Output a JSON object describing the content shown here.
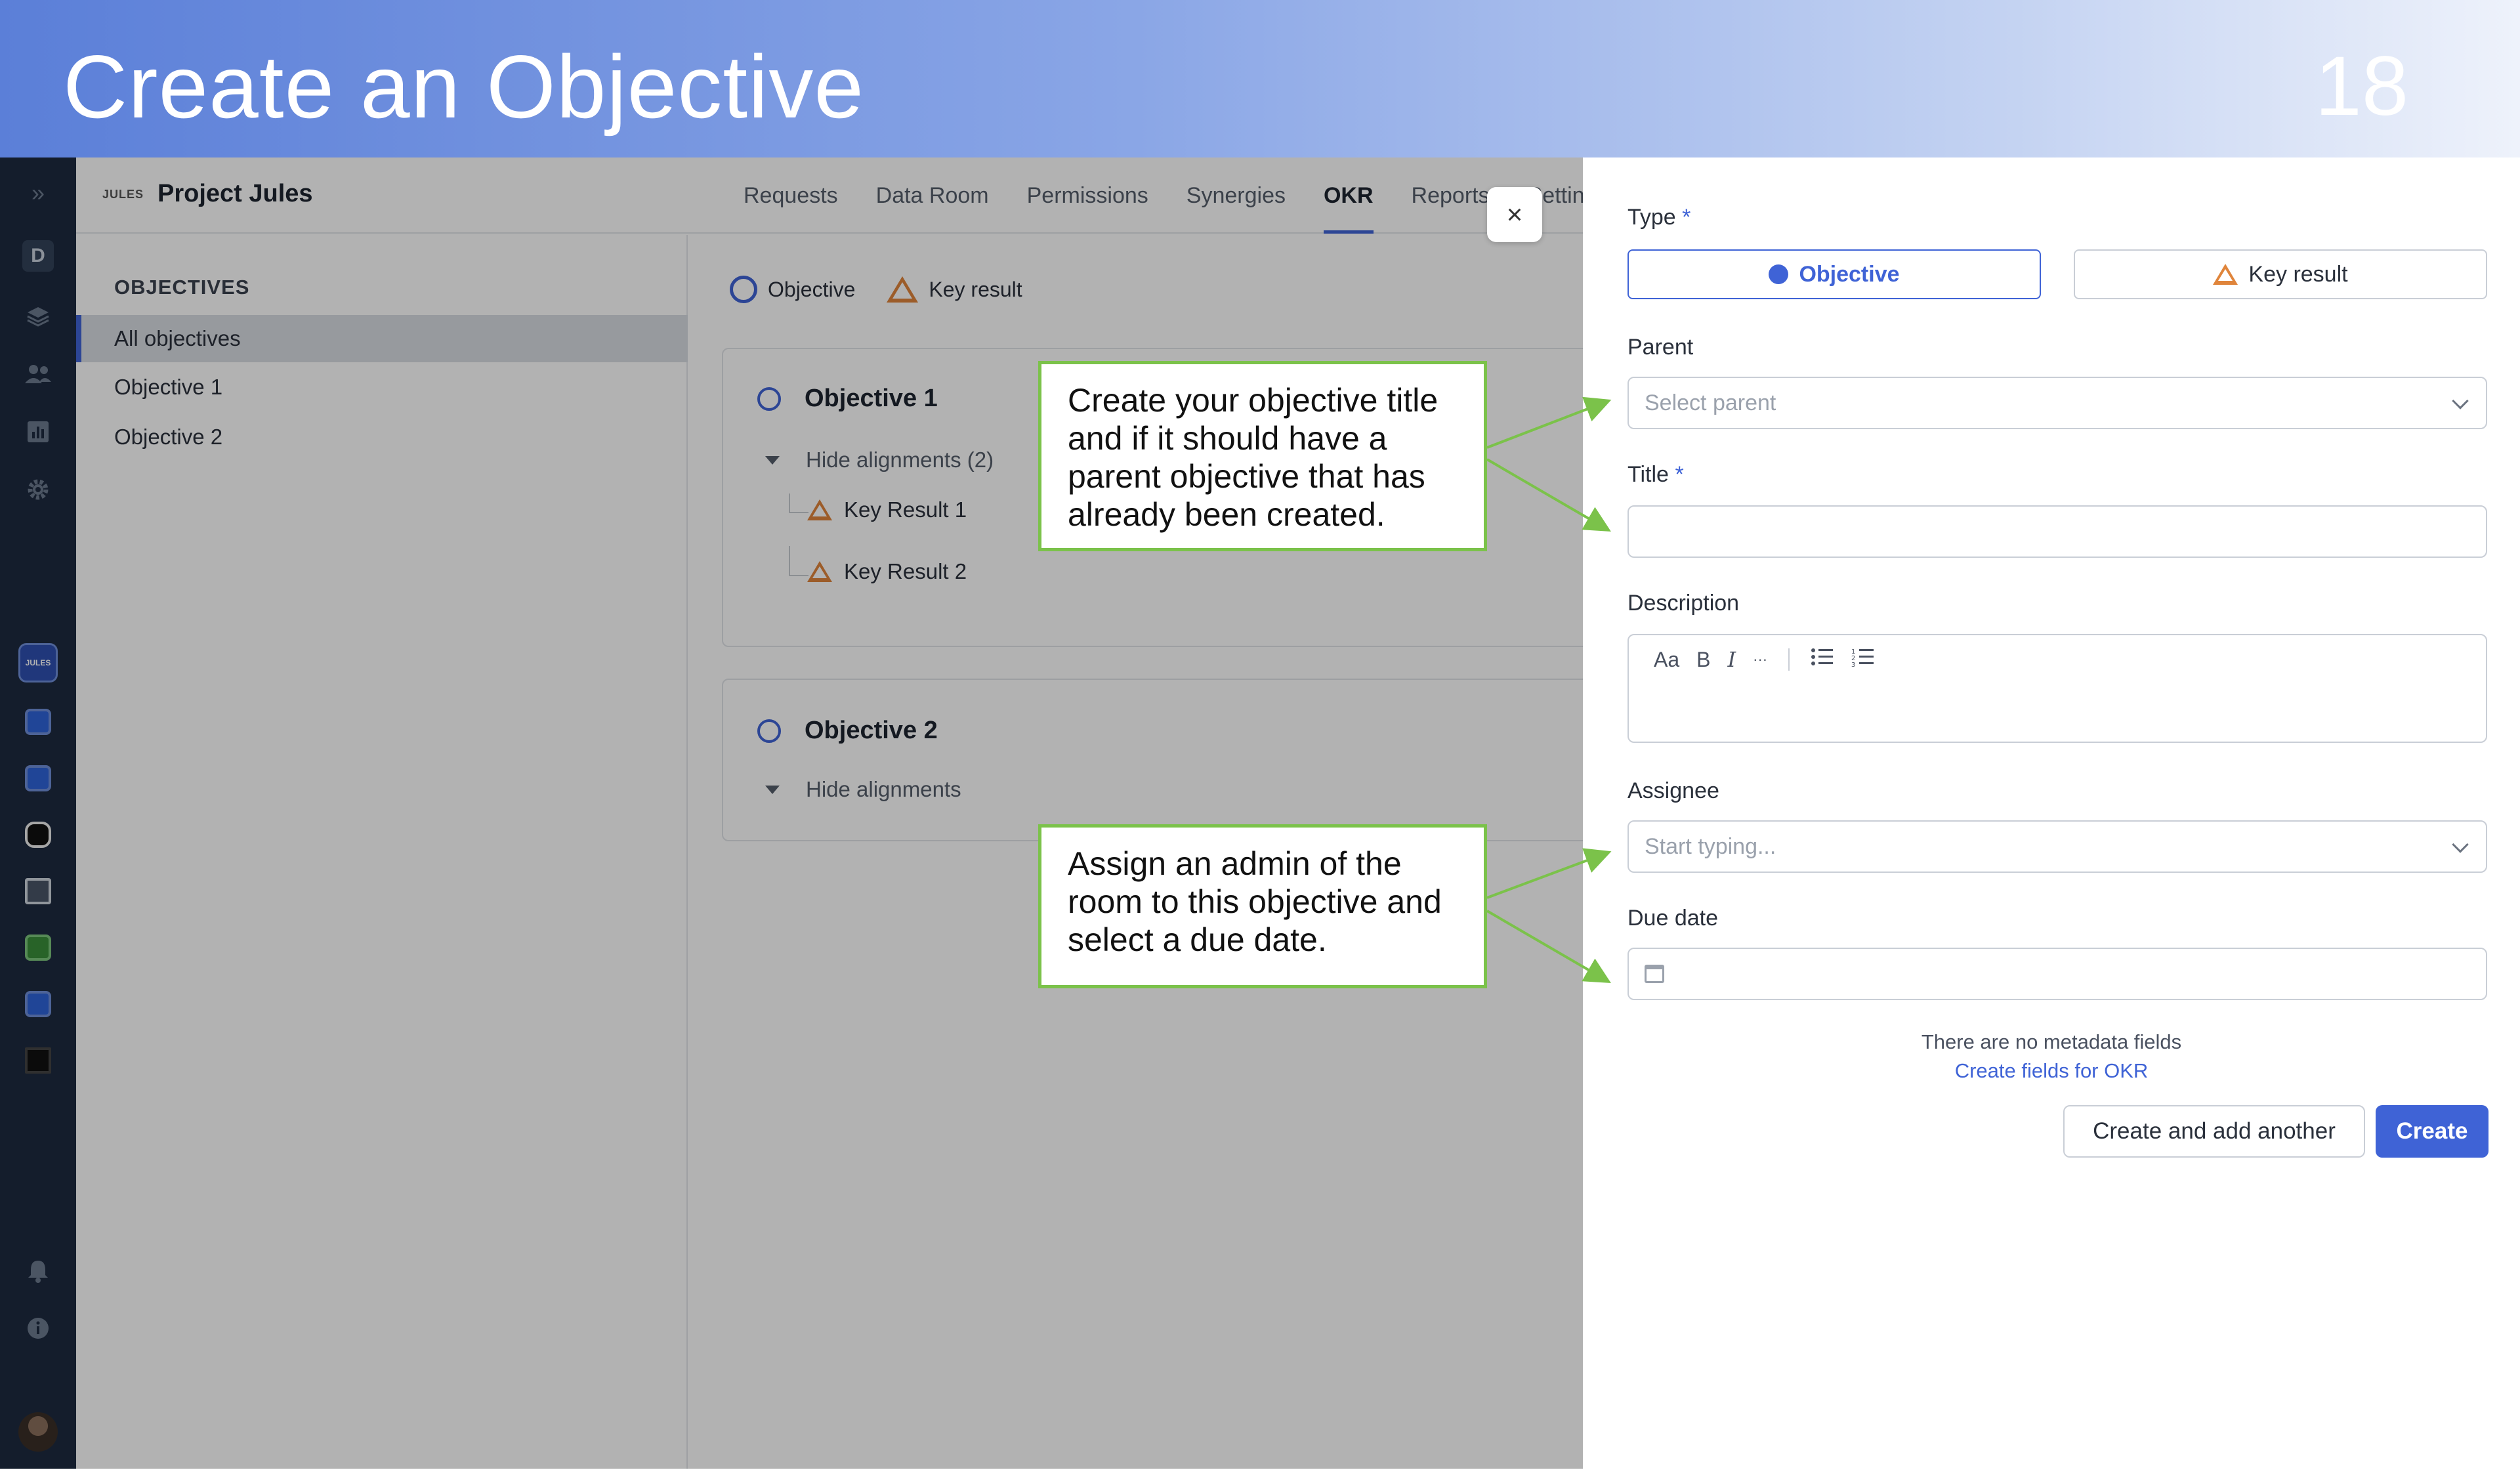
{
  "slide": {
    "title": "Create an Objective",
    "number": "18"
  },
  "rail": {
    "workspace_initial": "D",
    "active_app_label": "JULES"
  },
  "project": {
    "logo_text": "JULES",
    "name": "Project Jules"
  },
  "tabs": [
    {
      "label": "Requests"
    },
    {
      "label": "Data Room"
    },
    {
      "label": "Permissions"
    },
    {
      "label": "Synergies"
    },
    {
      "label": "OKR",
      "active": true
    },
    {
      "label": "Reports"
    },
    {
      "label": "Settin"
    }
  ],
  "sidebar": {
    "heading": "OBJECTIVES",
    "items": [
      {
        "label": "All objectives",
        "selected": true
      },
      {
        "label": "Objective 1"
      },
      {
        "label": "Objective 2"
      }
    ]
  },
  "filters": {
    "objective": "Objective",
    "key_result": "Key result"
  },
  "objectives": [
    {
      "title": "Objective 1",
      "toggle": "Hide alignments (2)",
      "key_results": [
        "Key Result 1",
        "Key Result 2"
      ]
    },
    {
      "title": "Objective 2",
      "toggle": "Hide alignments",
      "key_results": []
    }
  ],
  "drawer": {
    "close_glyph": "×",
    "type_label": "Type",
    "required_mark": "*",
    "type_options": {
      "objective": "Objective",
      "key_result": "Key result"
    },
    "parent_label": "Parent",
    "parent_placeholder": "Select parent",
    "title_label": "Title",
    "title_value": "",
    "description_label": "Description",
    "editor_tools": {
      "text_style": "Aa",
      "bold": "B",
      "italic": "I",
      "more": "···",
      "bullets": "≡",
      "numbered": "≡"
    },
    "assignee_label": "Assignee",
    "assignee_placeholder": "Start typing...",
    "due_date_label": "Due date",
    "due_date_value": "",
    "meta_note": "There are no metadata fields",
    "meta_link": "Create fields for OKR",
    "create_another": "Create and add another",
    "create": "Create"
  },
  "callouts": {
    "top": "Create your objective title and if it should have a parent objective that has already been created.",
    "bottom": "Assign an admin of the room to this objective and select a due date."
  },
  "colors": {
    "accent": "#3f63d6",
    "callout_border": "#7bc24a",
    "key_result_icon": "#e0853b",
    "rail": "#1d2a3f"
  }
}
